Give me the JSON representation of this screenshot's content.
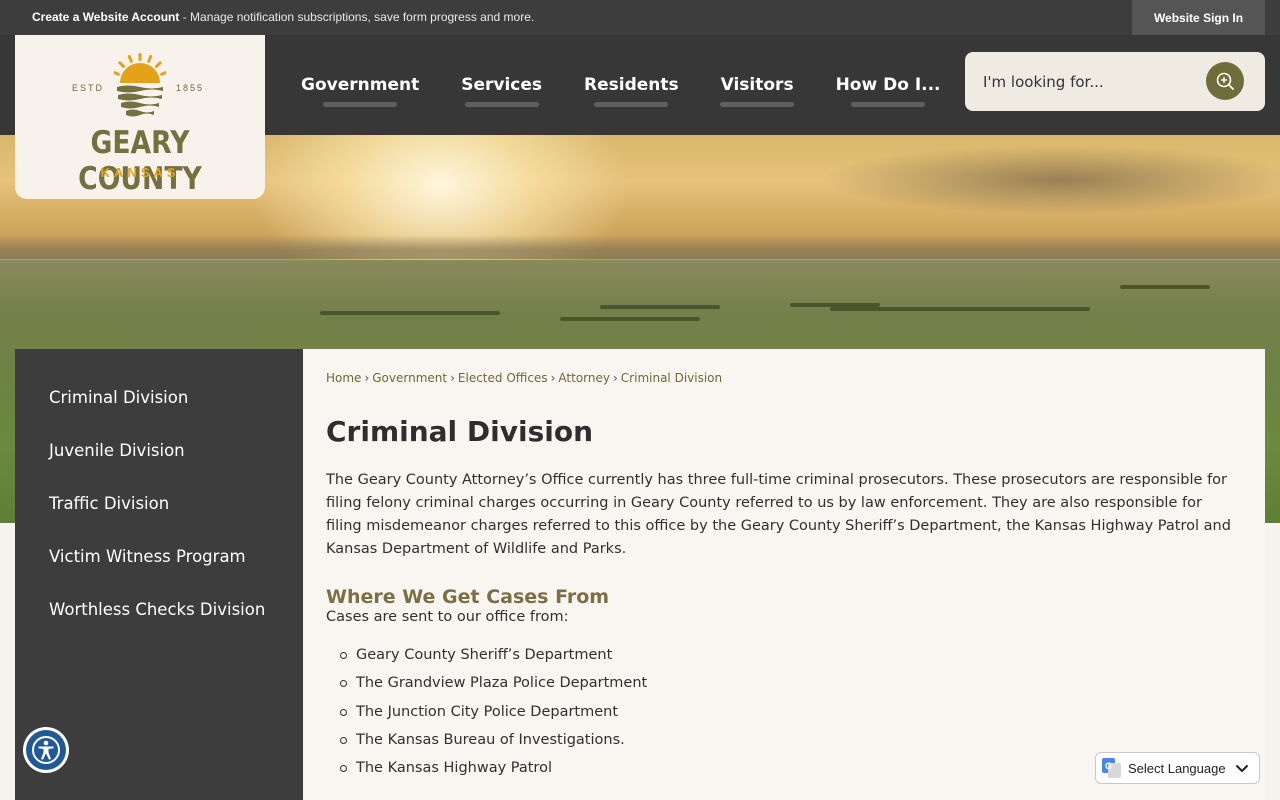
{
  "topbar": {
    "create_bold": "Create a Website Account",
    "create_rest": " - Manage notification subscriptions, save form progress and more.",
    "sign_in": "Website Sign In"
  },
  "logo": {
    "estd": "ESTD",
    "year": "1855",
    "name": "GEARY COUNTY",
    "state": "KANSAS"
  },
  "nav": [
    "Government",
    "Services",
    "Residents",
    "Visitors",
    "How Do I..."
  ],
  "search": {
    "placeholder": "I'm looking for..."
  },
  "sidebar": {
    "items": [
      "Criminal Division",
      "Juvenile Division",
      "Traffic Division",
      "Victim Witness Program",
      "Worthless Checks Division"
    ]
  },
  "breadcrumb": {
    "items": [
      "Home",
      "Government",
      "Elected Offices",
      "Attorney"
    ],
    "current": "Criminal Division"
  },
  "main": {
    "title": "Criminal Division",
    "intro": "The Geary County Attorney’s Office currently has three full-time criminal prosecutors. These prosecutors are responsible for filing felony criminal charges occurring in Geary County referred to us by law enforcement. They are also responsible for filing misdemeanor charges referred to this office by the Geary County Sheriff’s Department, the Kansas Highway Patrol and Kansas Department of Wildlife and Parks.",
    "section_title": "Where We Get Cases From",
    "section_lead": "Cases are sent to our office from:",
    "sources": [
      "Geary County Sheriff’s Department",
      "The Grandview Plaza Police Department",
      "The Junction City Police Department",
      "The Kansas Bureau of Investigations.",
      "The Kansas Highway Patrol"
    ]
  },
  "translate": {
    "label": "Select Language"
  },
  "colors": {
    "accent": "#6f6d3a",
    "sun": "#e3a21a",
    "dark": "#3d3d3d"
  },
  "icons": {
    "search": "search-icon",
    "accessibility": "accessibility-icon",
    "translate": "google-translate-icon"
  }
}
